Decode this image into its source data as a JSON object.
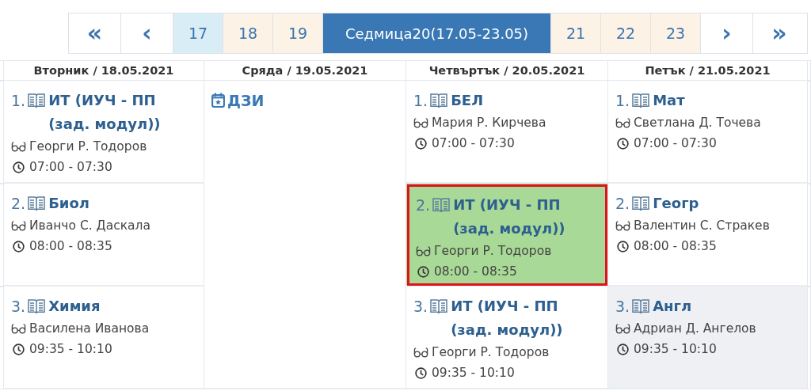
{
  "pagination": [
    {
      "kind": "first",
      "label": "«",
      "selected": false
    },
    {
      "kind": "prev",
      "label": "‹",
      "selected": false
    },
    {
      "kind": "day",
      "label": "17",
      "selected": false,
      "color": "#d9edf7"
    },
    {
      "kind": "day",
      "label": "18",
      "selected": false,
      "color": "#fcf3e6"
    },
    {
      "kind": "day",
      "label": "19",
      "selected": false,
      "color": "#fcf3e6"
    },
    {
      "kind": "week",
      "label": "Седмица20(17.05-23.05)",
      "selected": true
    },
    {
      "kind": "day",
      "label": "21",
      "selected": false,
      "color": "#fcf3e6"
    },
    {
      "kind": "day",
      "label": "22",
      "selected": false,
      "color": "#fcf3e6"
    },
    {
      "kind": "day",
      "label": "23",
      "selected": false,
      "color": "#fcf3e6"
    },
    {
      "kind": "next",
      "label": "›",
      "selected": false
    },
    {
      "kind": "last",
      "label": "»",
      "selected": false
    }
  ],
  "days": [
    {
      "heading": "Вторник / 18.05.2021",
      "cells": [
        {
          "kind": "lesson",
          "number": "1.",
          "subject": "ИТ (ИУЧ - ПП (зад. модул))",
          "teacher": "Георги Р. Тодоров",
          "time": "07:00 - 07:30",
          "selected": false,
          "shaded": false
        },
        {
          "kind": "lesson",
          "number": "2.",
          "subject": "Биол",
          "teacher": "Иванчо С. Даскала",
          "time": "08:00 - 08:35",
          "selected": false,
          "shaded": false
        },
        {
          "kind": "lesson",
          "number": "3.",
          "subject": "Химия",
          "teacher": "Василена Иванова",
          "time": "09:35 - 10:10",
          "selected": false,
          "shaded": false
        }
      ]
    },
    {
      "heading": "Сряда / 19.05.2021",
      "cells": [
        {
          "kind": "event",
          "title": "ДЗИ"
        }
      ]
    },
    {
      "heading": "Четвъртък / 20.05.2021",
      "cells": [
        {
          "kind": "lesson",
          "number": "1.",
          "subject": "БЕЛ",
          "teacher": "Мария Р. Кирчева",
          "time": "07:00 - 07:30",
          "selected": false,
          "shaded": false
        },
        {
          "kind": "lesson",
          "number": "2.",
          "subject": "ИТ (ИУЧ - ПП (зад. модул))",
          "teacher": "Георги Р. Тодоров",
          "time": "08:00 - 08:35",
          "selected": true,
          "shaded": false
        },
        {
          "kind": "lesson",
          "number": "3.",
          "subject": "ИТ (ИУЧ - ПП (зад. модул))",
          "teacher": "Георги Р. Тодоров",
          "time": "09:35 - 10:10",
          "selected": false,
          "shaded": false
        }
      ]
    },
    {
      "heading": "Петък / 21.05.2021",
      "cells": [
        {
          "kind": "lesson",
          "number": "1.",
          "subject": "Мат",
          "teacher": "Светлана Д. Точева",
          "time": "07:00 - 07:30",
          "selected": false,
          "shaded": false
        },
        {
          "kind": "lesson",
          "number": "2.",
          "subject": "Геогр",
          "teacher": "Валентин С. Стракев",
          "time": "08:00 - 08:35",
          "selected": false,
          "shaded": false
        },
        {
          "kind": "lesson",
          "number": "3.",
          "subject": "Англ",
          "teacher": "Адриан Д. Ангелов",
          "time": "09:35 - 10:10",
          "selected": false,
          "shaded": true
        }
      ]
    }
  ]
}
